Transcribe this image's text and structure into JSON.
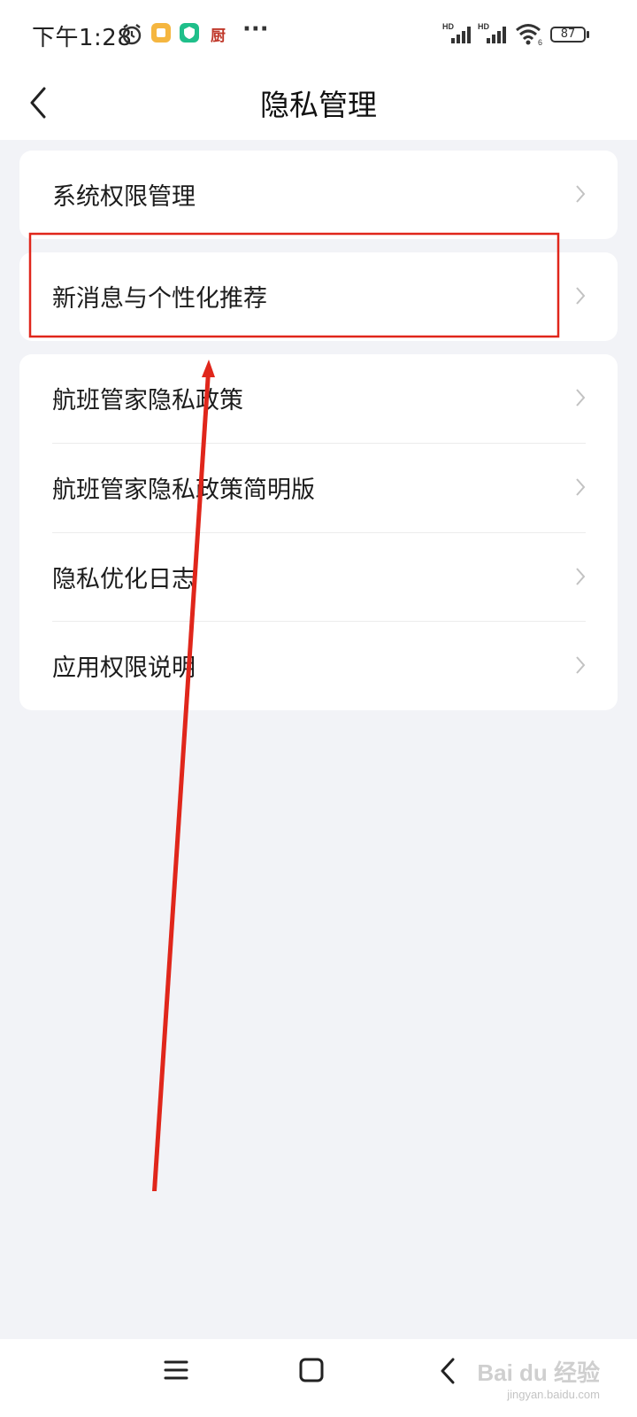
{
  "status_bar": {
    "time": "下午1:28",
    "notif_text_icon": "厨",
    "more": "···",
    "battery": "87",
    "signal_label": "HD",
    "wifi_badge": "6"
  },
  "header": {
    "title": "隐私管理"
  },
  "menu": {
    "group1": [
      {
        "label": "系统权限管理"
      }
    ],
    "group2": [
      {
        "label": "新消息与个性化推荐"
      }
    ],
    "group3": [
      {
        "label": "航班管家隐私政策"
      },
      {
        "label": "航班管家隐私政策简明版"
      },
      {
        "label": "隐私优化日志"
      },
      {
        "label": "应用权限说明"
      }
    ]
  },
  "annotation": {
    "color": "#e0261b"
  },
  "watermark": {
    "brand": "Bai du 经验",
    "url": "jingyan.baidu.com"
  },
  "colors": {
    "background": "#f2f3f7",
    "card": "#ffffff",
    "chevron": "#c2c2c2"
  }
}
